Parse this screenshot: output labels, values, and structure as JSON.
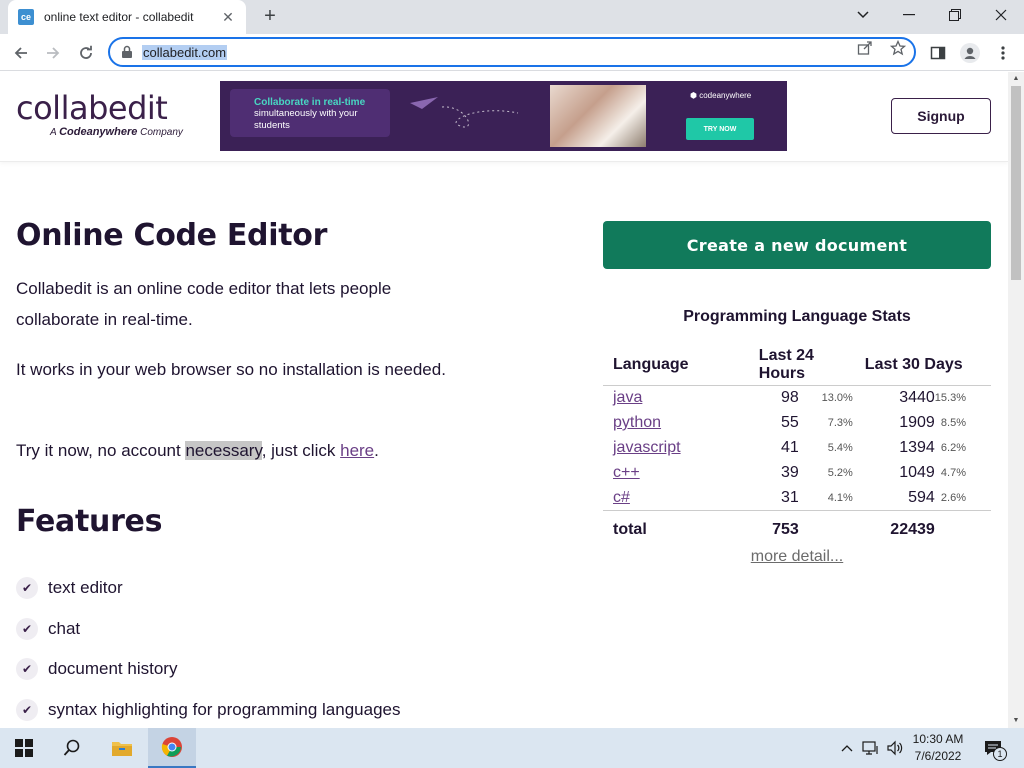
{
  "browser": {
    "tab_title": "online text editor - collabedit",
    "favicon_text": "ce",
    "url": "collabedit.com"
  },
  "site": {
    "logo_main": "collabedit",
    "logo_sub_prefix": "A",
    "logo_sub_brand": "Codeanywhere",
    "logo_sub_suffix": "Company",
    "ad": {
      "title": "Collaborate in real-time",
      "text": "simultaneously with your students",
      "brand": "codeanywhere",
      "button": "TRY NOW"
    },
    "signup_label": "Signup"
  },
  "main": {
    "title": "Online Code Editor",
    "para1": "Collabedit is an online code editor that lets people collaborate in real-time.",
    "para2": "It works in your web browser so no installation is needed.",
    "para3_before": "Try it now, no account",
    "para3_highlight": "necessary",
    "para3_middle": ", just click",
    "para3_link": "here",
    "para3_end": ".",
    "features_title": "Features",
    "features": [
      "text editor",
      "chat",
      "document history",
      "syntax highlighting for programming languages"
    ]
  },
  "sidebar": {
    "create_button": "Create a new document",
    "stats_title": "Programming Language Stats",
    "headers": [
      "Language",
      "Last 24 Hours",
      "Last 30 Days"
    ],
    "rows": [
      {
        "lang": "java",
        "d24": "98",
        "p24": "13.0%",
        "d30": "3440",
        "p30": "15.3%"
      },
      {
        "lang": "python",
        "d24": "55",
        "p24": "7.3%",
        "d30": "1909",
        "p30": "8.5%"
      },
      {
        "lang": "javascript",
        "d24": "41",
        "p24": "5.4%",
        "d30": "1394",
        "p30": "6.2%"
      },
      {
        "lang": "c++",
        "d24": "39",
        "p24": "5.2%",
        "d30": "1049",
        "p30": "4.7%"
      },
      {
        "lang": "c#",
        "d24": "31",
        "p24": "4.1%",
        "d30": "594",
        "p30": "2.6%"
      }
    ],
    "total_label": "total",
    "total_24": "753",
    "total_30": "22439",
    "more_detail": "more detail..."
  },
  "taskbar": {
    "time": "10:30 AM",
    "date": "7/6/2022",
    "notification_count": "1"
  },
  "colors": {
    "brand": "#3a2049",
    "button_green": "#117a5b",
    "link": "#6a3f86"
  }
}
